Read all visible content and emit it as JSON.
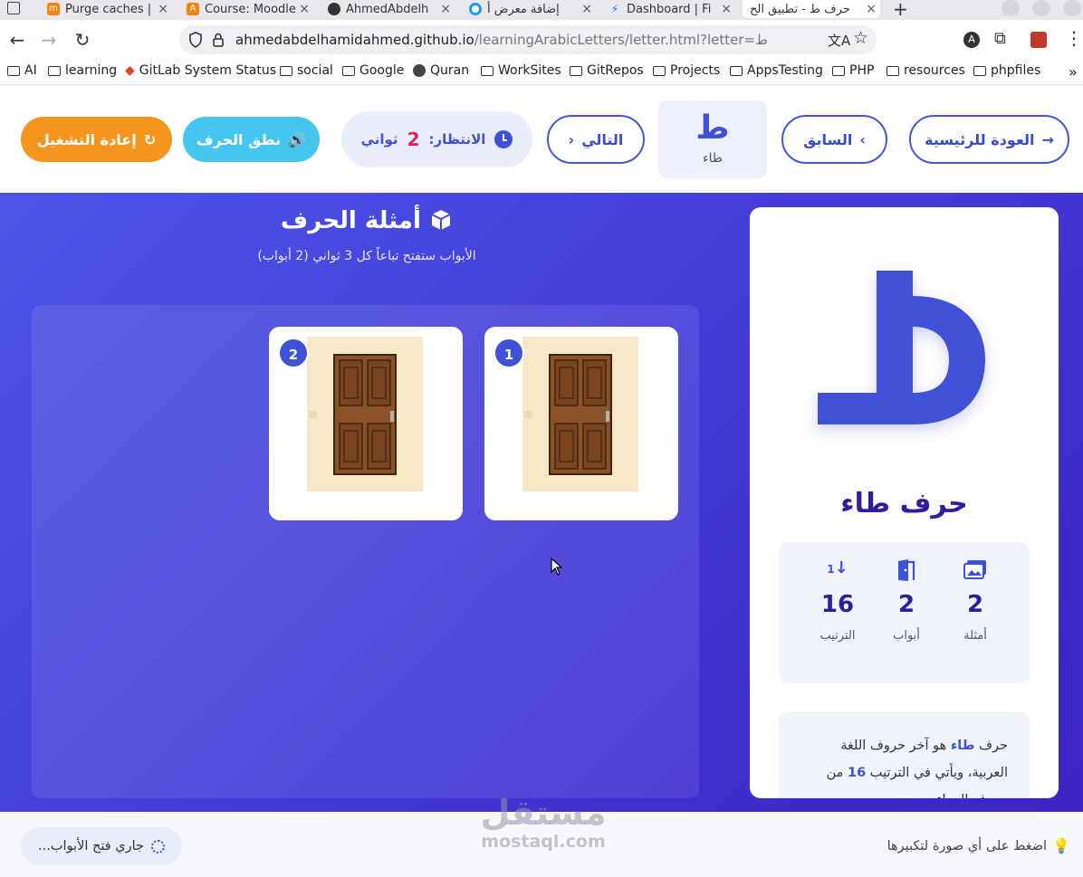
{
  "browser": {
    "tabs": [
      {
        "title": "Purge caches |",
        "favicon": "moodle-icon"
      },
      {
        "title": "Course: Moodle",
        "favicon": "moodle-a-icon"
      },
      {
        "title": "AhmedAbdelh",
        "favicon": "github-icon"
      },
      {
        "title": "إضافة معرض أ",
        "favicon": "blue-circle-icon"
      },
      {
        "title": "Dashboard | Fi",
        "favicon": "firebase-icon"
      },
      {
        "title": "حرف ط - تطبيق الح",
        "favicon": "page-icon",
        "active": true
      }
    ],
    "new_tab": "+",
    "url_host": "ahmedabdelhamidahmed.github.io",
    "url_path": "/learningArabicLetters/letter.html?letter=ط",
    "bookmarks": [
      "AI",
      "learning",
      "GitLab System Status",
      "social",
      "Google",
      "Quran",
      "WorkSites",
      "GitRepos",
      "Projects",
      "AppsTesting",
      "PHP",
      "resources",
      "phpfiles"
    ],
    "bookmarks_more": "»"
  },
  "header": {
    "back_home": "العودة للرئيسية",
    "previous": "السابق",
    "current_letter": "ط",
    "current_letter_name": "طاء",
    "next": "التالي",
    "timer_label": "الانتظار:",
    "timer_value": "2",
    "timer_unit": "ثواني",
    "pronounce": "نطق الحرف",
    "replay": "إعادة التشغيل"
  },
  "examples": {
    "title": "أمثلة الحرف",
    "subtitle": "الأبواب ستفتح تباعاً كل 3 ثواني (2 أبواب)",
    "doors": [
      {
        "number": "1"
      },
      {
        "number": "2"
      }
    ]
  },
  "letter_card": {
    "letter": "ط",
    "title": "حرف طاء",
    "stats": [
      {
        "icon": "images-icon",
        "value": "2",
        "label": "أمثلة"
      },
      {
        "icon": "door-open-icon",
        "value": "2",
        "label": "أبواب"
      },
      {
        "icon": "sort-order-icon",
        "value": "16",
        "label": "الترتيب"
      }
    ],
    "desc_1": "حرف",
    "desc_name": "طاء",
    "desc_2": "هو آخر حروف اللغة العربية، ويأتي في الترتيب",
    "desc_num": "16",
    "desc_3": "من حروف الهجاء"
  },
  "footer": {
    "hint": "اضغط على أي صورة لتكبيرها",
    "status": "جاري فتح الأبواب..."
  },
  "watermark": {
    "ar": "مستقل",
    "en": "mostaql.com"
  },
  "colors": {
    "primary": "#3f51d6",
    "accent_orange": "#f5951e",
    "accent_cyan": "#45c6ee",
    "timer_red": "#e0245e"
  }
}
